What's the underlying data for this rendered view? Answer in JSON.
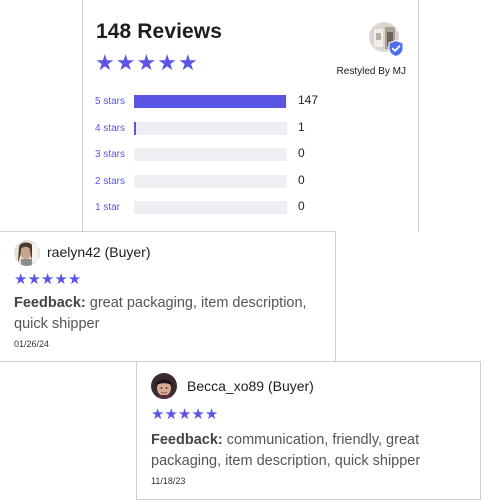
{
  "summary": {
    "review_count_title": "148 Reviews",
    "average_stars": 5,
    "seller_label": "Restyled By MJ",
    "accent_color": "#5b55e6",
    "breakdown": [
      {
        "label": "5 stars",
        "count": "147",
        "fraction": 0.993
      },
      {
        "label": "4 stars",
        "count": "1",
        "fraction": 0.007
      },
      {
        "label": "3 stars",
        "count": "0",
        "fraction": 0
      },
      {
        "label": "2 stars",
        "count": "0",
        "fraction": 0
      },
      {
        "label": "1 star",
        "count": "0",
        "fraction": 0
      }
    ]
  },
  "reviews": [
    {
      "username": "raelyn42 (Buyer)",
      "stars": 5,
      "feedback_label": "Feedback:",
      "feedback_text": "great packaging, item description, quick shipper",
      "date": "01/26/24"
    },
    {
      "username": "Becca_xo89 (Buyer)",
      "stars": 5,
      "feedback_label": "Feedback:",
      "feedback_text": "communication, friendly, great packaging, item description, quick shipper",
      "date": "11/18/23"
    }
  ],
  "icons": {
    "star": "star-icon",
    "verified": "verified-shield-icon"
  }
}
